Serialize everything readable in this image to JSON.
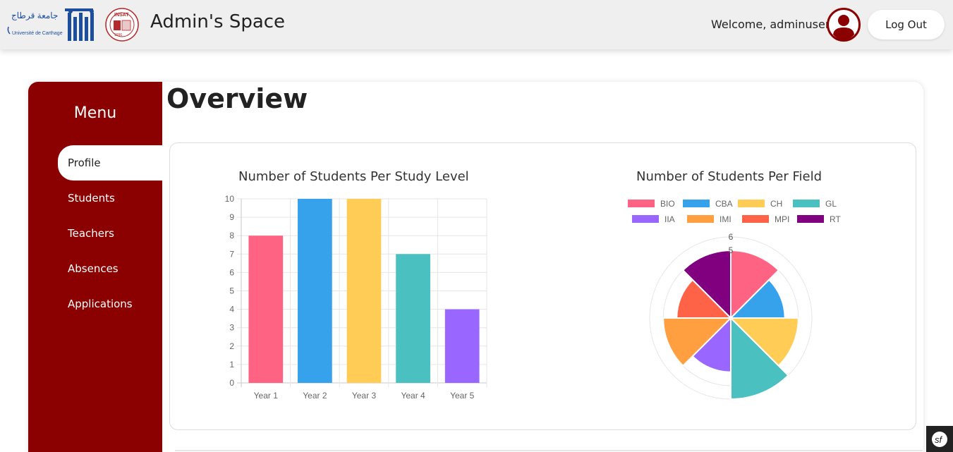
{
  "header": {
    "logo_university_arabic": "جامعة قرطاج",
    "logo_university_french": "Université de Carthage",
    "logo_insat_text": "INSAT",
    "logo_insat_year": "1996",
    "title": "Admin's Space",
    "welcome": "Welcome, adminuser",
    "logout_label": "Log Out",
    "avatar_icon": "user-circle-icon"
  },
  "sidebar": {
    "title": "Menu",
    "items": [
      {
        "label": "Profile",
        "active": true
      },
      {
        "label": "Students",
        "active": false
      },
      {
        "label": "Teachers",
        "active": false
      },
      {
        "label": "Absences",
        "active": false
      },
      {
        "label": "Applications",
        "active": false
      }
    ]
  },
  "main": {
    "heading": "Overview"
  },
  "colors": {
    "brand": "#8b0000",
    "bio": "#ff6384",
    "cba": "#36a2eb",
    "ch": "#ffcd56",
    "gl": "#4bc0c0",
    "iia": "#9966ff",
    "imi": "#ff9f40",
    "mpi": "#ff6347",
    "rt": "#800080"
  },
  "chart_data": [
    {
      "type": "bar",
      "title": "Number of Students Per Study Level",
      "categories": [
        "Year 1",
        "Year 2",
        "Year 3",
        "Year 4",
        "Year 5"
      ],
      "values": [
        8,
        10,
        10,
        7,
        4
      ],
      "colors": [
        "#ff6384",
        "#36a2eb",
        "#ffcd56",
        "#4bc0c0",
        "#9966ff"
      ],
      "ylim": [
        0,
        10
      ],
      "yticks": [
        "0",
        "1",
        "2",
        "3",
        "4",
        "5",
        "6",
        "7",
        "8",
        "9",
        "10"
      ],
      "grid": true,
      "legend": "none"
    },
    {
      "type": "polarArea",
      "title": "Number of Students Per Field",
      "categories": [
        "BIO",
        "CBA",
        "CH",
        "GL",
        "IIA",
        "IMI",
        "MPI",
        "RT"
      ],
      "values": [
        5,
        4,
        5,
        6,
        4,
        5,
        4,
        5
      ],
      "colors": [
        "#ff6384",
        "#36a2eb",
        "#ffcd56",
        "#4bc0c0",
        "#9966ff",
        "#ff9f40",
        "#ff6347",
        "#800080"
      ],
      "rlim": [
        0,
        6
      ],
      "rticks": [
        "5",
        "6"
      ],
      "legend": "top"
    }
  ],
  "footer": {
    "toolbar_icon": "symfony-icon",
    "toolbar_label": "sf"
  }
}
